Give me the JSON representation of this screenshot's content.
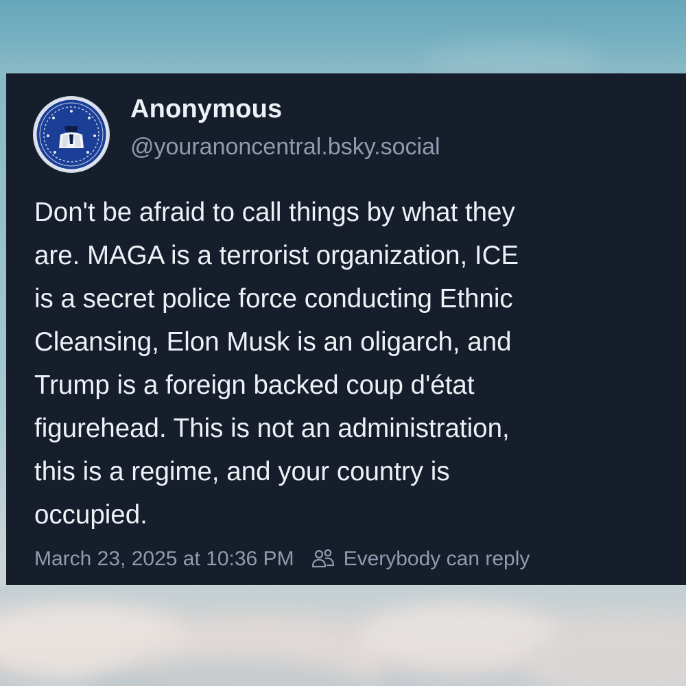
{
  "post": {
    "author": {
      "display_name": "Anonymous",
      "handle": "@youranoncentral.bsky.social",
      "avatar_icon": "anonymous-emblem-icon"
    },
    "text": "Don't be afraid to call things by what they\nare. MAGA is a terrorist organization, ICE\nis a secret police force conducting Ethnic\nCleansing, Elon Musk is an oligarch, and\nTrump is a foreign backed coup d'état\nfigurehead. This is not an administration,\nthis is a regime, and your country is\noccupied.",
    "timestamp": "March 23, 2025 at 10:36 PM",
    "reply_setting": {
      "icon": "people-icon",
      "label": "Everybody can reply"
    }
  },
  "colors": {
    "card_background": "#161e2b",
    "primary_text": "#eef1f6",
    "secondary_text": "#8f9bb0",
    "avatar_blue": "#1b3f97"
  }
}
